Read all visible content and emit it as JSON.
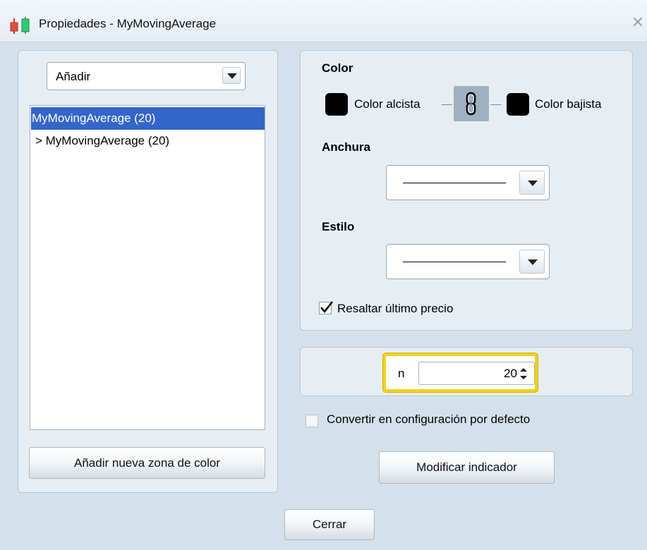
{
  "window": {
    "title": "Propiedades - MyMovingAverage",
    "close_symbol": "✕"
  },
  "left": {
    "add_combo_value": "Añadir",
    "list_items": [
      "MyMovingAverage (20)",
      "> MyMovingAverage (20)"
    ],
    "add_zone_button": "Añadir nueva zona de color"
  },
  "style": {
    "color_heading": "Color",
    "color_up_label": "Color alcista",
    "color_down_label": "Color bajista",
    "color_up": "#000000",
    "color_down": "#000000",
    "link_icon": "chain-link-icon",
    "width_heading": "Anchura",
    "style_heading": "Estilo",
    "highlight_label": "Resaltar último precio",
    "highlight_checked": true
  },
  "params": {
    "n_label": "n",
    "n_value": "20"
  },
  "default_checkbox_label": "Convertir en configuración por defecto",
  "default_checked": false,
  "modify_button": "Modificar indicador",
  "close_button": "Cerrar",
  "colors": {
    "selection": "#3465c8",
    "highlight_border": "#f2d11a"
  }
}
